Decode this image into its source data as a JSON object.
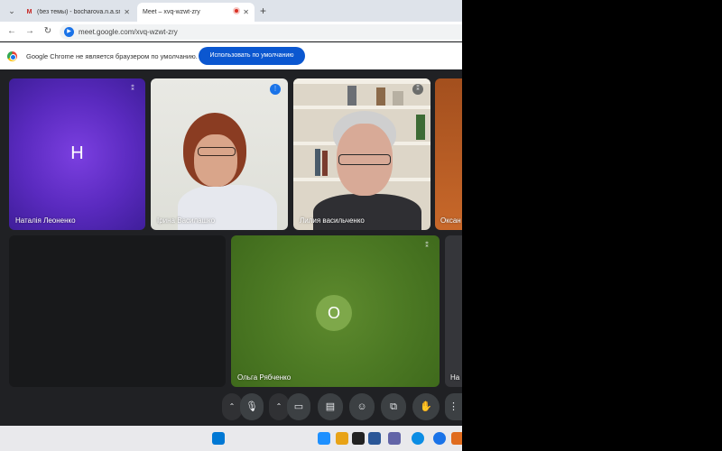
{
  "browser": {
    "tabs": [
      {
        "label": "(без темы) - bocharova.n.a.sru",
        "favicon": "gmail-icon",
        "active": false
      },
      {
        "label": "Meet – xvq-wzwt-zry",
        "favicon": "meet-icon",
        "active": true
      }
    ],
    "new_tab_symbol": "+",
    "url": "meet.google.com/xvq-wzwt-zry"
  },
  "infobar": {
    "message": "Google Chrome не является браузером по умолчанию.",
    "button_label": "Использовать по умолчанию"
  },
  "meet": {
    "participants": [
      {
        "name": "Наталія Леоненко",
        "avatar_letter": "Н",
        "tile_color": "#5a2abf",
        "mic": "muted"
      },
      {
        "name": "Ірина Василашко",
        "video": true,
        "mic": "speaking"
      },
      {
        "name": "Лилия васильченко",
        "video": true,
        "mic": "muted"
      },
      {
        "name": "Оксан",
        "tile_color": "#b85a24"
      },
      {
        "name": "Ольга Рябченко",
        "avatar_letter": "О",
        "tile_color": "#4d7a24",
        "mic": "muted"
      },
      {
        "name": "На"
      }
    ],
    "controls": [
      "chevron-up-icon",
      "mic-icon",
      "chevron-up-icon",
      "camera-icon",
      "captions-icon",
      "emoji-icon",
      "present-icon",
      "raise-hand-icon",
      "more-vert-icon"
    ]
  },
  "colors": {
    "meet_background": "#202124",
    "accent_blue": "#0b57d0"
  }
}
